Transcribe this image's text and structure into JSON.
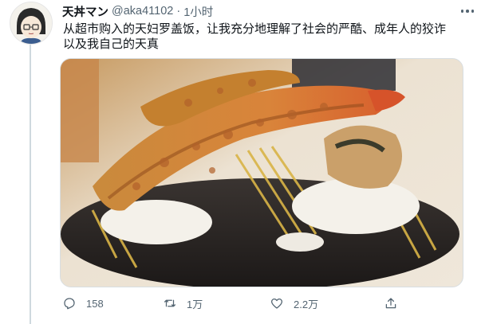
{
  "tweet": {
    "display_name": "天丼マン",
    "handle": "@aka41102",
    "separator": "·",
    "time": "1小时",
    "text": "从超市购入的天妇罗盖饭，让我充分地理解了社会的严酷、成年人的狡诈\n以及我自己的天真"
  },
  "icons": {
    "avatar": "avatar-anime-character",
    "more": "more-dots-icon",
    "reply": "reply-bubble-icon",
    "retweet": "retweet-icon",
    "like": "heart-icon",
    "share": "share-upload-icon"
  },
  "actions": {
    "reply_count": "158",
    "retweet_count": "1万",
    "like_count": "2.2万"
  },
  "colors": {
    "text": "#0f1419",
    "secondary": "#536471",
    "border": "#cfd9de"
  }
}
